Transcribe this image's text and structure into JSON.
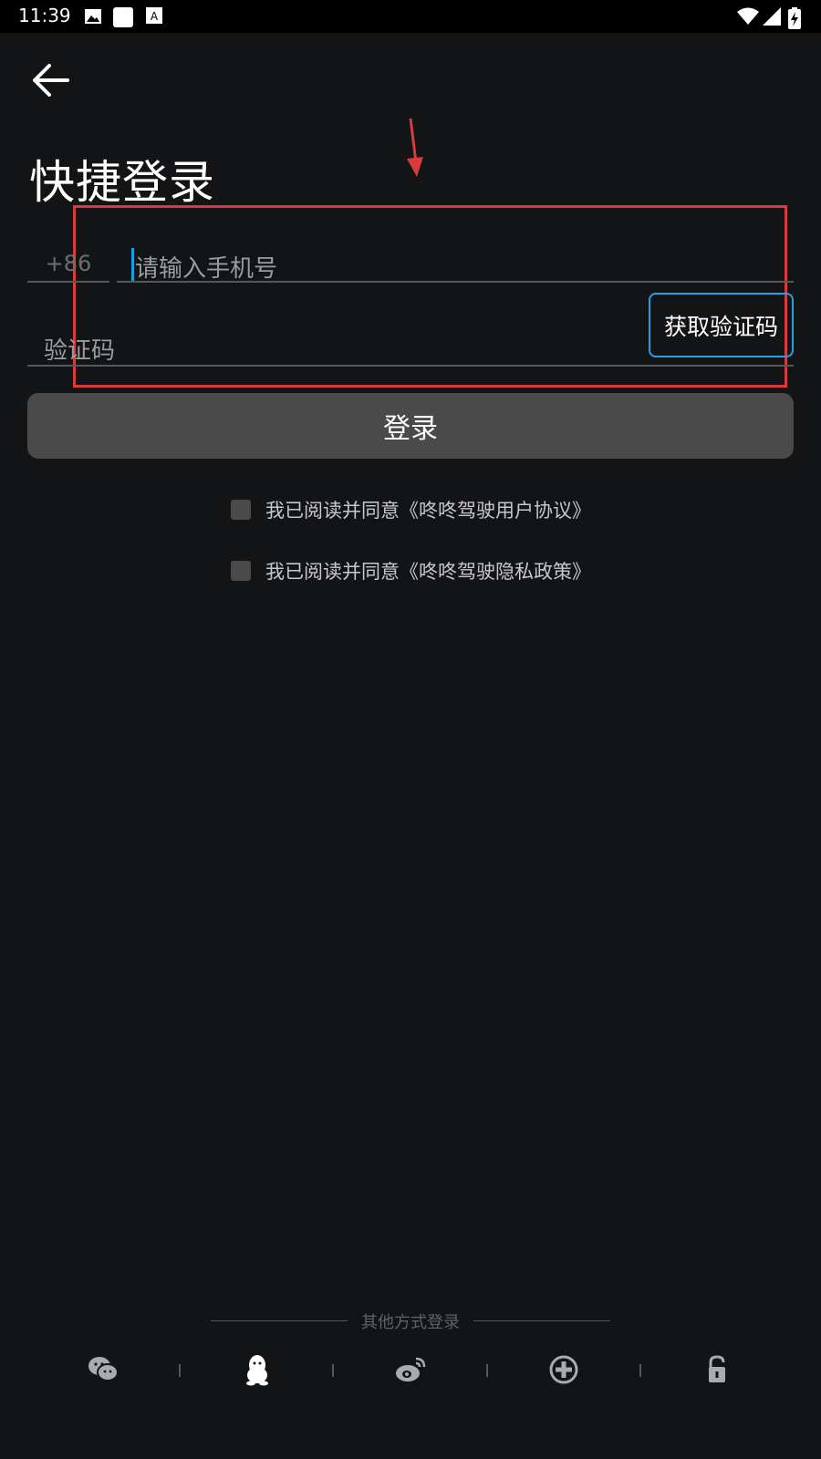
{
  "status_bar": {
    "time": "11:39",
    "icons": [
      "image-icon",
      "white-square-icon",
      "text-icon",
      "wifi-icon",
      "signal-icon",
      "battery-charging-icon"
    ]
  },
  "header": {
    "back_icon": "back-arrow-icon",
    "title": "快捷登录"
  },
  "form": {
    "country_code": "+86",
    "phone_placeholder": "请输入手机号",
    "code_placeholder": "验证码",
    "get_code_label": "获取验证码",
    "login_label": "登录"
  },
  "agreements": [
    {
      "checked": false,
      "text": "我已阅读并同意《咚咚驾驶用户协议》"
    },
    {
      "checked": false,
      "text": "我已阅读并同意《咚咚驾驶隐私政策》"
    }
  ],
  "other_login": {
    "label": "其他方式登录",
    "methods": [
      "wechat-icon",
      "qq-icon",
      "weibo-icon",
      "add-icon",
      "lock-icon"
    ]
  },
  "colors": {
    "background": "#131416",
    "accent": "#1fa3e6",
    "annotation": "#d83b3b",
    "button": "#4a4a4b"
  }
}
